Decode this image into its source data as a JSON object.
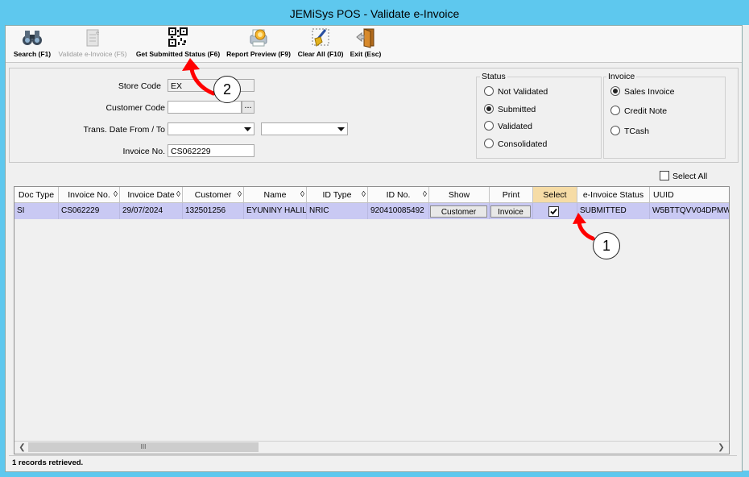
{
  "window": {
    "title": "JEMiSys POS - Validate e-Invoice"
  },
  "toolbar": {
    "search": "Search (F1)",
    "validate": "Validate e-Invoice (F5)",
    "get_status": "Get Submitted Status (F6)",
    "report_preview": "Report Preview (F9)",
    "clear_all": "Clear All (F10)",
    "exit": "Exit (Esc)"
  },
  "filters": {
    "store_code_label": "Store Code",
    "store_code_value": "EX",
    "customer_code_label": "Customer Code",
    "customer_code_value": "",
    "lookup_label": "...",
    "trans_date_label": "Trans. Date From / To",
    "date_from": "",
    "date_to": "",
    "invoice_no_label": "Invoice No.",
    "invoice_no_value": "CS062229"
  },
  "status_group": {
    "title": "Status",
    "options": [
      "Not Validated",
      "Submitted",
      "Validated",
      "Consolidated"
    ],
    "selected": "Submitted"
  },
  "invoice_group": {
    "title": "Invoice",
    "options": [
      "Sales Invoice",
      "Credit Note",
      "TCash"
    ],
    "selected": "Sales Invoice"
  },
  "select_all_label": "Select All",
  "grid": {
    "columns": [
      "Doc Type",
      "Invoice No.",
      "Invoice Date",
      "Customer",
      "Name",
      "ID Type",
      "ID No.",
      "Show",
      "Print",
      "Select",
      "e-Invoice Status",
      "UUID"
    ],
    "sort_glyph": "◊",
    "rows": [
      {
        "doc_type": "SI",
        "invoice_no": "CS062229",
        "invoice_date": "29/07/2024",
        "customer": "132501256",
        "name": "EYUNINY HALIL",
        "id_type": "NRIC",
        "id_no": "920410085492",
        "show_button": "Customer",
        "print_button": "Invoice",
        "selected": true,
        "status": "SUBMITTED",
        "uuid": "W5BTTQVV04DPMW"
      }
    ],
    "scroll_thumb": "III"
  },
  "status_bar": {
    "message": "1 records retrieved."
  },
  "annotations": {
    "callout_1": "1",
    "callout_2": "2",
    "arrow_color": "#ff0000"
  }
}
